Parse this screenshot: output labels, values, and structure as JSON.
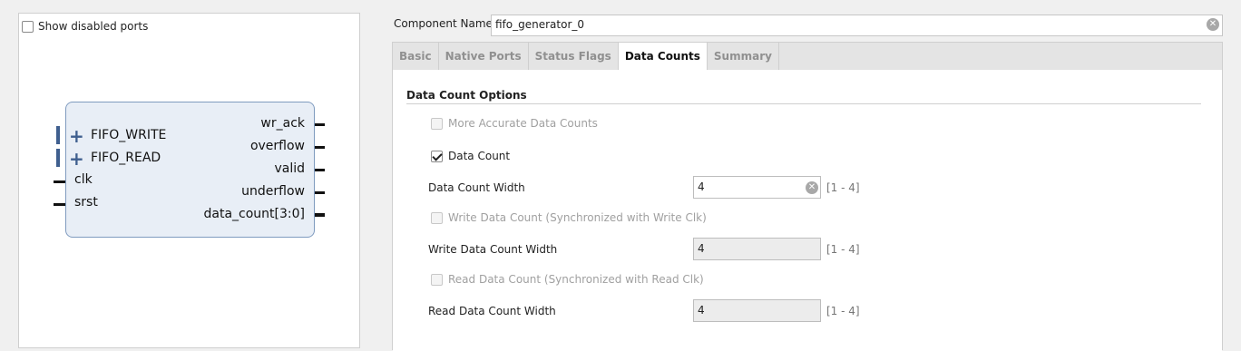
{
  "left": {
    "show_disabled_ports_label": "Show disabled ports",
    "symbol": {
      "bus_ports": [
        "FIFO_WRITE",
        "FIFO_READ"
      ],
      "input_ports": [
        "clk",
        "srst"
      ],
      "output_ports": [
        "wr_ack",
        "overflow",
        "valid",
        "underflow",
        "data_count[3:0]"
      ]
    }
  },
  "component": {
    "label": "Component Name",
    "value": "fifo_generator_0"
  },
  "tabs": [
    "Basic",
    "Native Ports",
    "Status Flags",
    "Data Counts",
    "Summary"
  ],
  "active_tab": "Data Counts",
  "data_counts": {
    "section_title": "Data Count Options",
    "more_accurate_label": "More Accurate Data Counts",
    "more_accurate_checked": false,
    "data_count_label": "Data Count",
    "data_count_checked": true,
    "data_count_width_label": "Data Count Width",
    "data_count_width_value": "4",
    "data_count_width_range": "[1 - 4]",
    "write_data_count_label": "Write Data Count (Synchronized with Write Clk)",
    "write_data_count_checked": false,
    "write_data_count_width_label": "Write Data Count Width",
    "write_data_count_width_value": "4",
    "write_data_count_width_range": "[1 - 4]",
    "read_data_count_label": "Read Data Count (Synchronized with Read Clk)",
    "read_data_count_checked": false,
    "read_data_count_width_label": "Read Data Count Width",
    "read_data_count_width_value": "4",
    "read_data_count_width_range": "[1 - 4]"
  },
  "icons": {
    "clear": "clear-circle-x-icon",
    "bus": "bus-plus-icon"
  }
}
